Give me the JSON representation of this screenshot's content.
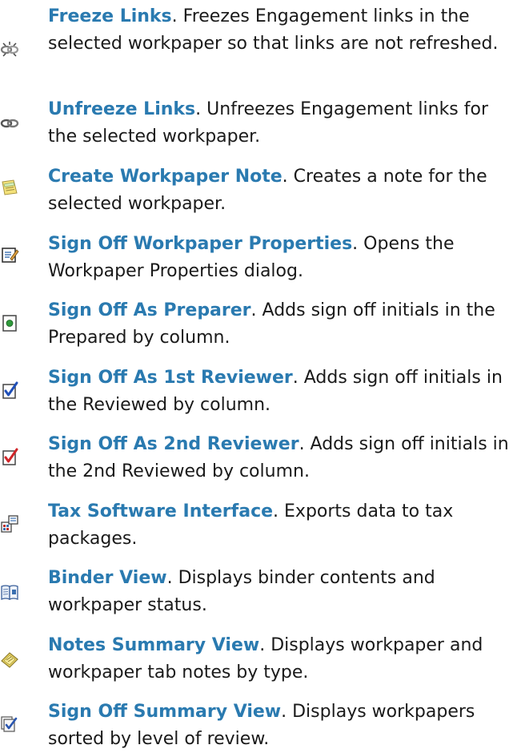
{
  "items": [
    {
      "icon": "freeze-links-icon",
      "title": "Freeze Links",
      "separator": ".",
      "description": " Freezes Engagement links in the selected workpaper so that links are not refreshed."
    },
    {
      "icon": "unfreeze-links-icon",
      "title": "Unfreeze Links",
      "separator": ".",
      "description": " Unfreezes Engagement links for the selected workpaper."
    },
    {
      "icon": "workpaper-note-icon",
      "title": "Create Workpaper Note",
      "separator": ".",
      "description": " Creates a note for the selected workpaper."
    },
    {
      "icon": "workpaper-properties-icon",
      "title": "Sign Off Workpaper Properties",
      "separator": ".",
      "description": " Opens the Workpaper Properties dialog."
    },
    {
      "icon": "preparer-signoff-icon",
      "title": "Sign Off As Preparer",
      "separator": ".",
      "description": " Adds sign off initials in the Prepared by column."
    },
    {
      "icon": "first-reviewer-check-icon",
      "title": "Sign Off As 1st Reviewer",
      "separator": ".",
      "description": " Adds sign off initials in the Reviewed by column."
    },
    {
      "icon": "second-reviewer-check-icon",
      "title": "Sign Off As 2nd Reviewer",
      "separator": ".",
      "description": " Adds sign off initials in the 2nd Reviewed by column."
    },
    {
      "icon": "tax-software-icon",
      "title": "Tax Software Interface",
      "separator": ".",
      "description": " Exports data to tax packages."
    },
    {
      "icon": "binder-view-icon",
      "title": "Binder View",
      "separator": ".",
      "description": " Displays binder contents and workpaper status."
    },
    {
      "icon": "notes-summary-icon",
      "title": "Notes Summary View",
      "separator": ".",
      "description": " Displays workpaper and workpaper tab notes by type."
    },
    {
      "icon": "signoff-summary-icon",
      "title": "Sign Off Summary View",
      "separator": ".",
      "description": " Displays workpapers sorted by level of review."
    }
  ]
}
